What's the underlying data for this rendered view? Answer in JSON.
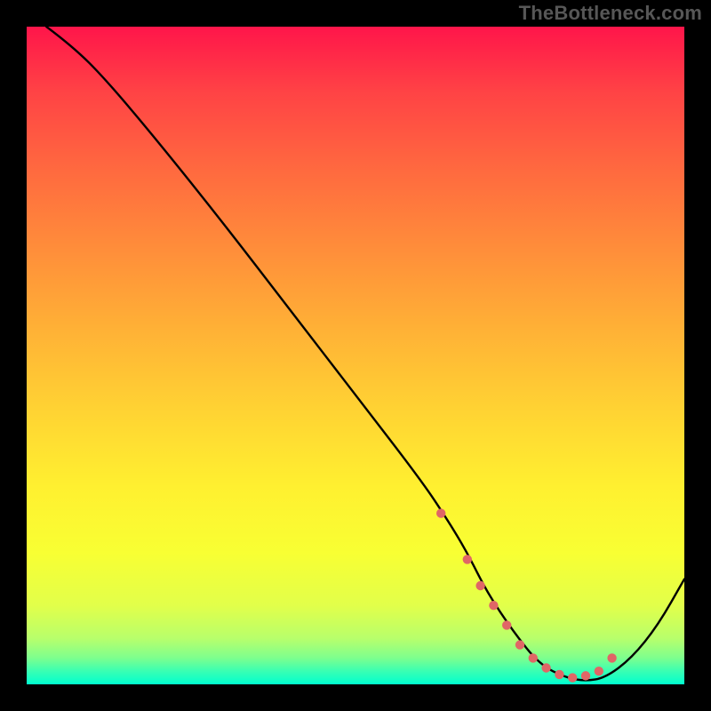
{
  "watermark": "TheBottleneck.com",
  "chart_data": {
    "type": "line",
    "title": "",
    "xlabel": "",
    "ylabel": "",
    "xlim": [
      0,
      100
    ],
    "ylim": [
      0,
      100
    ],
    "background_gradient": {
      "top": "#ff154a",
      "bottom": "#00ffcf"
    },
    "series": [
      {
        "name": "bottleneck-curve",
        "stroke": "#000000",
        "x": [
          3,
          7,
          12,
          20,
          30,
          40,
          50,
          60,
          64,
          67,
          70,
          74,
          78,
          82,
          85,
          88,
          92,
          96,
          100
        ],
        "y": [
          100,
          97,
          92,
          82.5,
          70,
          57,
          44,
          31,
          25,
          20,
          14,
          8,
          3,
          1,
          0.5,
          1,
          4,
          9,
          16
        ]
      }
    ],
    "markers": {
      "name": "valley-dots",
      "color": "#e06666",
      "radius": 5.2,
      "x": [
        63,
        67,
        69,
        71,
        73,
        75,
        77,
        79,
        81,
        83,
        85,
        87,
        89
      ],
      "y": [
        26,
        19,
        15,
        12,
        9,
        6,
        4,
        2.5,
        1.5,
        1,
        1.3,
        2,
        4
      ]
    }
  }
}
